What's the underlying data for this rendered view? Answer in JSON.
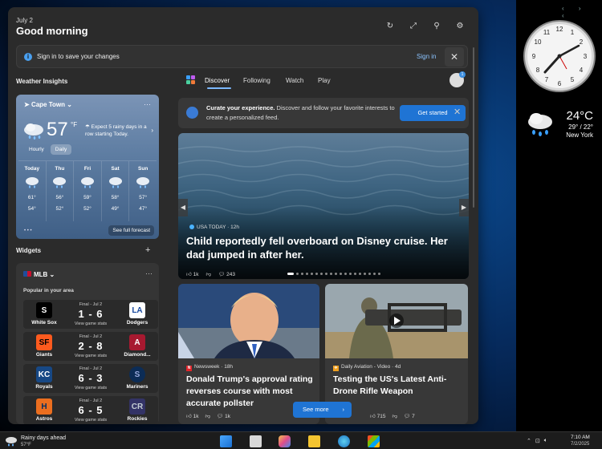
{
  "header": {
    "date": "July 2",
    "greeting": "Good morning"
  },
  "signin": {
    "message": "Sign in to save your changes",
    "link": "Sign in"
  },
  "weather_section_title": "Weather Insights",
  "weather": {
    "location": "Cape Town",
    "temp": "57",
    "unit": "°F",
    "expect": "Expect 5 rainy days in a row starting Today.",
    "tabs": [
      "Hourly",
      "Daily"
    ],
    "days": [
      {
        "name": "Today",
        "hi": "61°",
        "lo": "54°"
      },
      {
        "name": "Thu",
        "hi": "56°",
        "lo": "52°"
      },
      {
        "name": "Fri",
        "hi": "59°",
        "lo": "52°"
      },
      {
        "name": "Sat",
        "hi": "58°",
        "lo": "49°"
      },
      {
        "name": "Sun",
        "hi": "57°",
        "lo": "47°"
      }
    ],
    "full_forecast": "See full forecast"
  },
  "widgets_title": "Widgets",
  "mlb": {
    "title": "MLB",
    "subtitle": "Popular in your area",
    "games": [
      {
        "status": "Final - Jul 2",
        "score": "1 - 6",
        "stats": "View game stats",
        "team1": "White Sox",
        "team2": "Dodgers",
        "logo1": "S",
        "logo2": "LA",
        "c1": "#000000",
        "c2": "#1a4ba0"
      },
      {
        "status": "Final - Jul 2",
        "score": "2 - 8",
        "stats": "View game stats",
        "team1": "Giants",
        "team2": "Diamond...",
        "logo1": "SF",
        "logo2": "A",
        "c1": "#fd5a1e",
        "c2": "#a71930"
      },
      {
        "status": "Final - Jul 2",
        "score": "6 - 3",
        "stats": "View game stats",
        "team1": "Royals",
        "team2": "Mariners",
        "logo1": "KC",
        "logo2": "S",
        "c1": "#174885",
        "c2": "#0c2c56"
      },
      {
        "status": "Final - Jul 2",
        "score": "6 - 5",
        "stats": "View game stats",
        "team1": "Astros",
        "team2": "Rockies",
        "logo1": "H",
        "logo2": "CR",
        "c1": "#eb6e1f",
        "c2": "#333366"
      }
    ]
  },
  "feed": {
    "tabs": [
      "Discover",
      "Following",
      "Watch",
      "Play"
    ],
    "avatar_badge": "1",
    "curate_bold": "Curate your experience.",
    "curate_rest": " Discover and follow your favorite interests to create a personalized feed.",
    "curate_button": "Get started",
    "hero": {
      "source": "USA TODAY · 12h",
      "title": "Child reportedly fell overboard on Disney cruise. Her dad jumped in after her.",
      "likes": "1k",
      "comments": "243"
    },
    "cards": [
      {
        "source": "Newsweek · 18h",
        "title": "Donald Trump's approval rating reverses course with most accurate pollster",
        "likes": "1k",
        "comments": "1k"
      },
      {
        "source": "Daily Aviation - Video · 4d",
        "title": "Testing the US's Latest Anti-Drone Rifle Weapon",
        "likes": "715",
        "comments": "7"
      }
    ],
    "see_more": "See more"
  },
  "desktop_gadget": {
    "temp": "24°C",
    "range": "29° / 22°",
    "city": "New York"
  },
  "taskbar": {
    "weather_line1": "Rainy days ahead",
    "weather_line2": "57°F",
    "time": "7:10 AM",
    "date": "7/2/2025"
  }
}
